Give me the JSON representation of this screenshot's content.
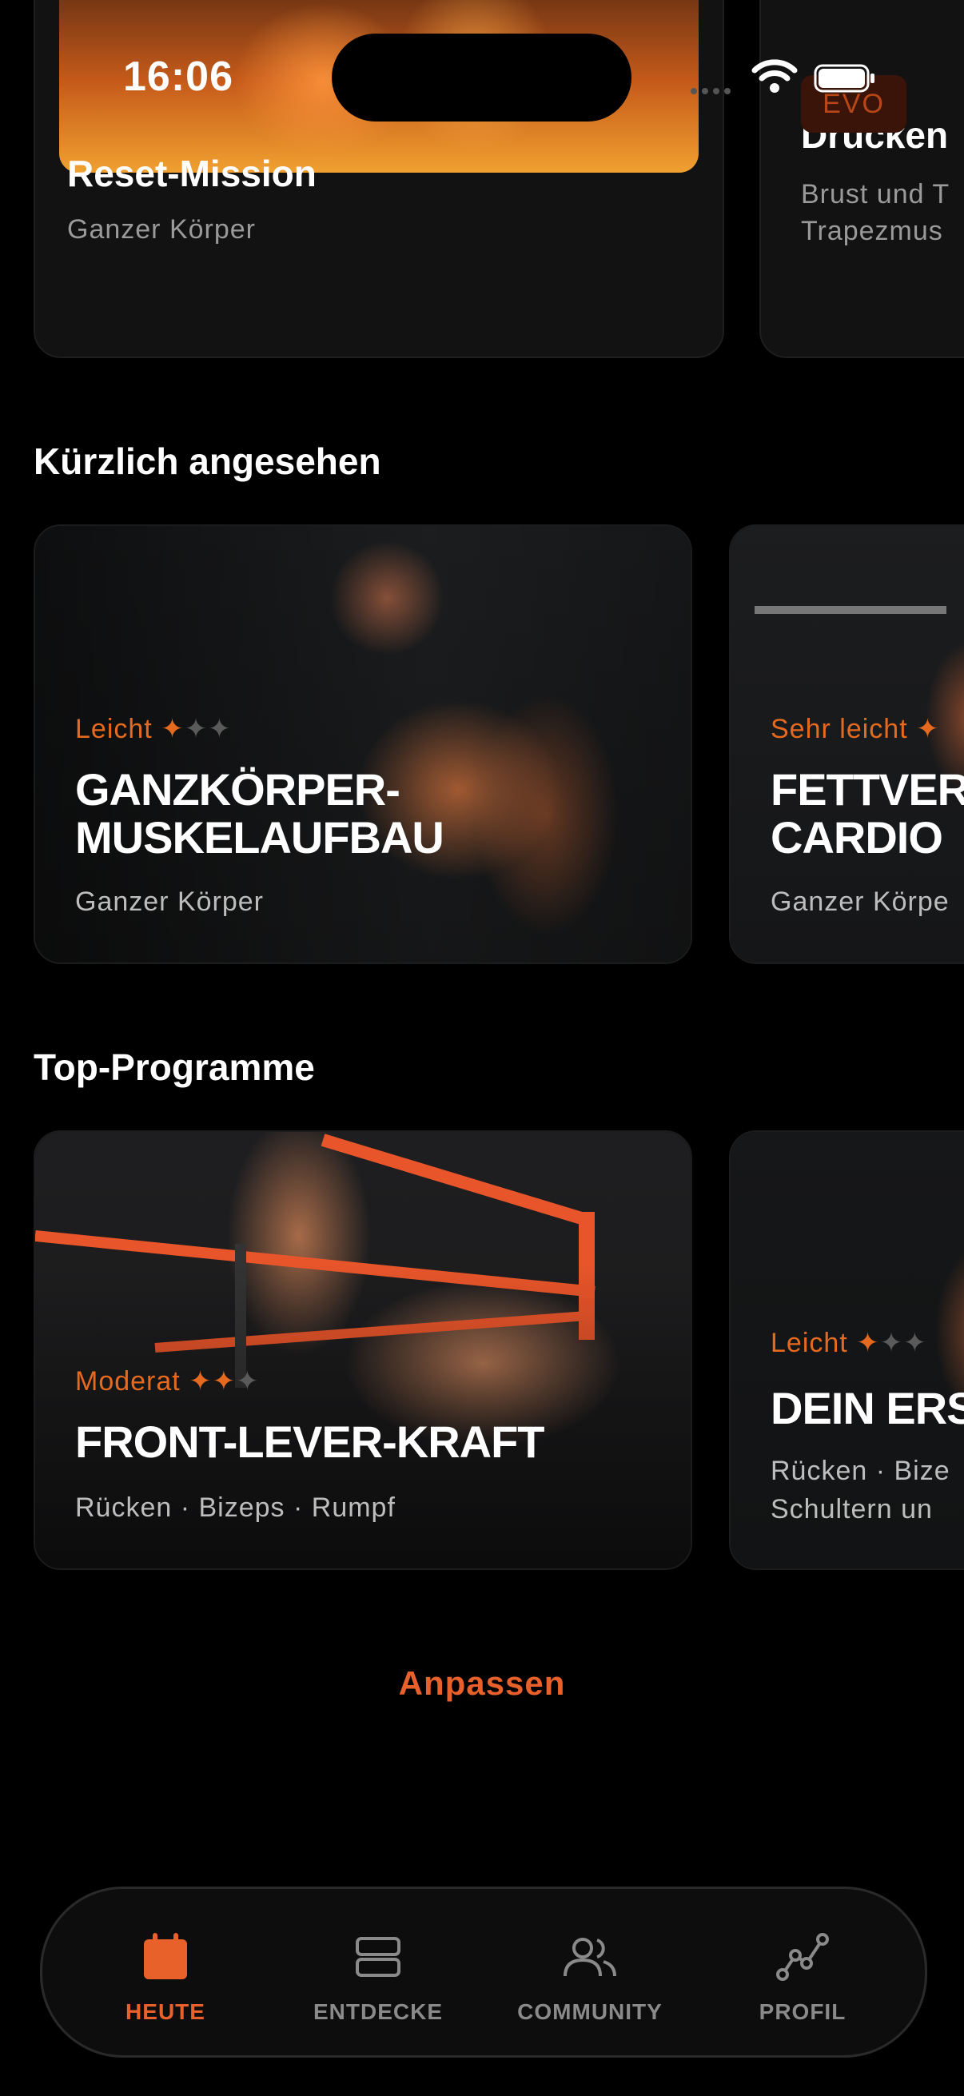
{
  "status": {
    "time": "16:06"
  },
  "top_cards": [
    {
      "title": "Reset-Mission",
      "subtitle": "Ganzer Körper"
    },
    {
      "badge": "EVO",
      "title": "Drücken",
      "subtitle_line1": "Brust und T",
      "subtitle_line2": "Trapezmus"
    }
  ],
  "recent": {
    "heading": "Kürzlich angesehen",
    "cards": [
      {
        "level": "Leicht",
        "title_line1": "GANZKÖRPER-",
        "title_line2": "MUSKELAUFBAU",
        "subtitle": "Ganzer Körper",
        "stars": 1
      },
      {
        "level": "Sehr leicht",
        "title_line1": "FETTVER",
        "title_line2": "CARDIO",
        "subtitle": "Ganzer Körpe",
        "stars": 1
      }
    ]
  },
  "top_programs": {
    "heading": "Top-Programme",
    "cards": [
      {
        "level": "Moderat",
        "title": "FRONT-LEVER-KRAFT",
        "subtitle": "Rücken · Bizeps · Rumpf",
        "stars": 2
      },
      {
        "level": "Leicht",
        "title": "DEIN ERS",
        "subtitle_line1": "Rücken · Bize",
        "subtitle_line2": "Schultern un",
        "stars": 1
      }
    ]
  },
  "customize_label": "Anpassen",
  "tabs": [
    {
      "label": "HEUTE",
      "icon": "calendar-icon",
      "active": true
    },
    {
      "label": "ENTDECKE",
      "icon": "stack-icon",
      "active": false
    },
    {
      "label": "COMMUNITY",
      "icon": "people-icon",
      "active": false
    },
    {
      "label": "PROFIL",
      "icon": "chart-icon",
      "active": false
    }
  ],
  "colors": {
    "accent": "#e8602a",
    "level": "#e56a1f",
    "card_bg": "#121212",
    "background": "#000000"
  }
}
